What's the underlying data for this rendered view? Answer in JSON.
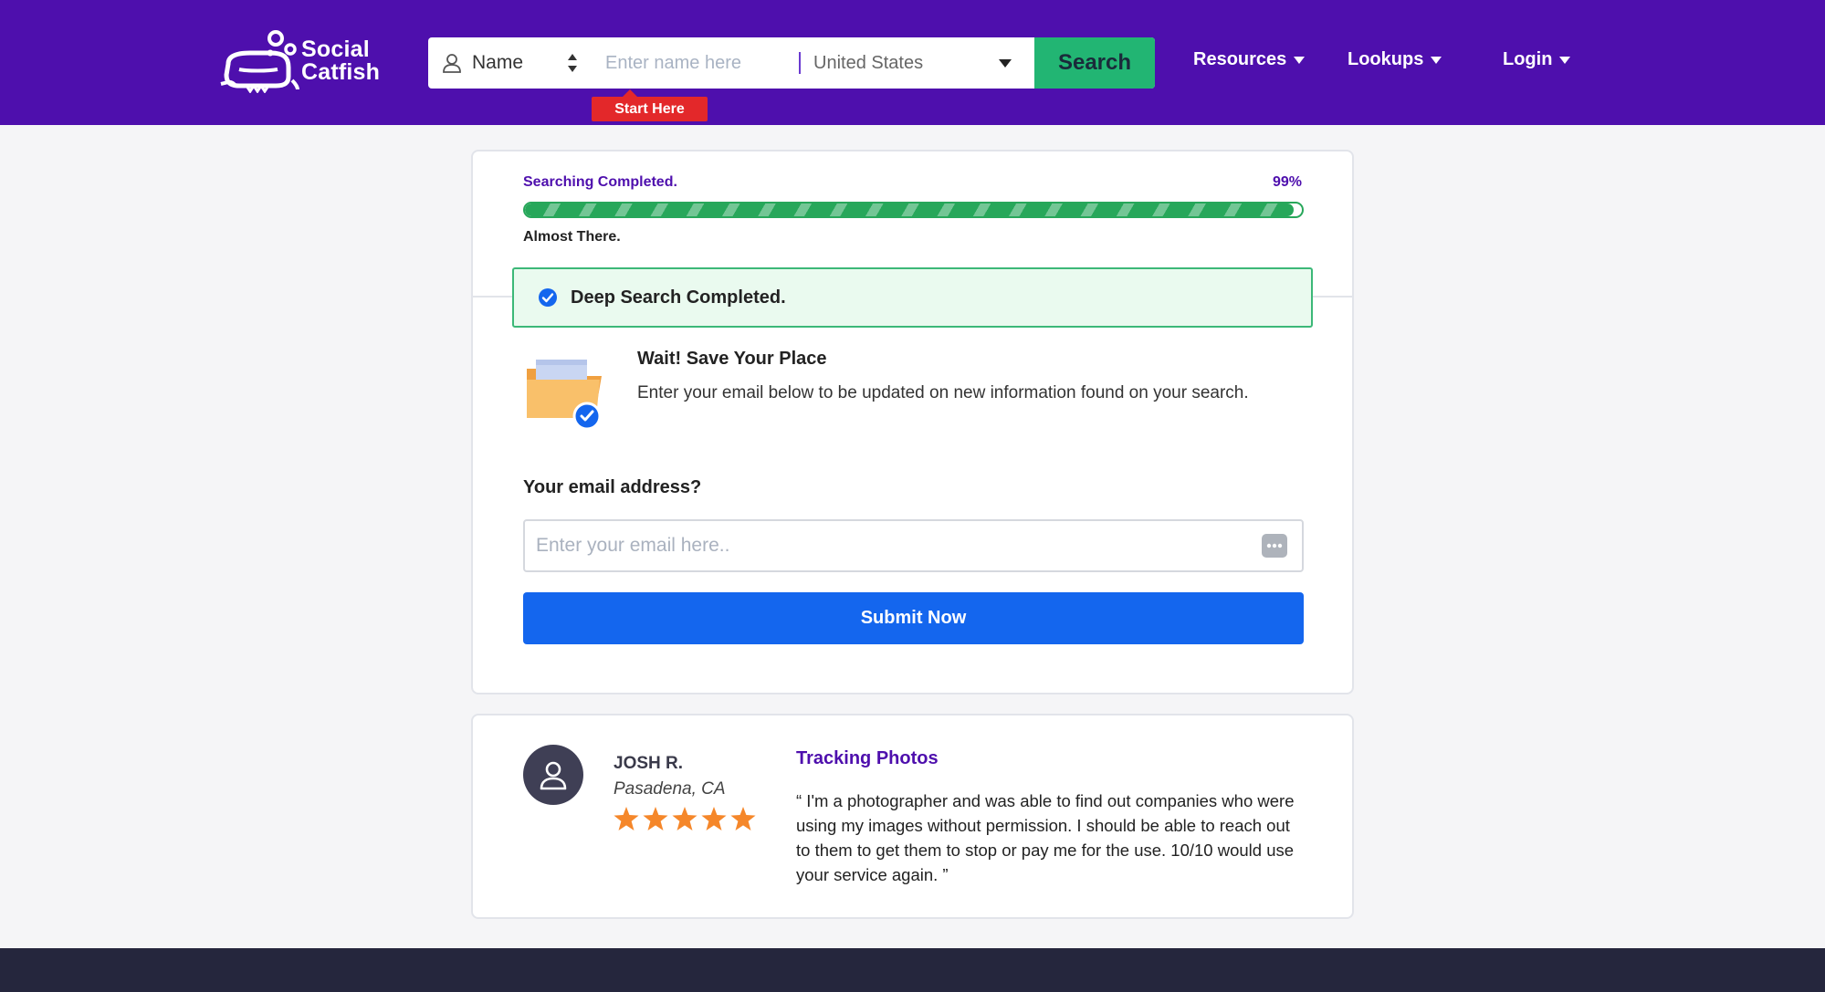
{
  "header": {
    "logo_line1": "Social",
    "logo_line2": "Catfish",
    "search_type": "Name",
    "name_placeholder": "Enter name here",
    "country": "United States",
    "search_button": "Search",
    "start_here": "Start Here",
    "nav": [
      {
        "label": "Resources"
      },
      {
        "label": "Lookups"
      },
      {
        "label": "Login"
      }
    ],
    "colors": {
      "bar": "#4e0fad",
      "search_button": "#22b573",
      "start_here": "#e3282a"
    }
  },
  "progress": {
    "status": "Searching Completed.",
    "percent_label": "99%",
    "percent_value": 0.99,
    "sub_status": "Almost There."
  },
  "success": {
    "icon": "check-circle-icon",
    "text": "Deep Search Completed."
  },
  "save": {
    "icon": "folder-check-icon",
    "title": "Wait! Save Your Place",
    "description": "Enter your email below to be updated on new information found on your search."
  },
  "email": {
    "label": "Your email address?",
    "placeholder": "Enter your email here..",
    "value": "",
    "submit": "Submit Now"
  },
  "review": {
    "name": "JOSH R.",
    "location": "Pasadena, CA",
    "rating": 5,
    "title": "Tracking Photos",
    "body": "“ I'm a photographer and was able to find out companies who were using my images without permission. I should be able to reach out to them to get them to stop or pay me for the use. 10/10 would use your service again. ”"
  }
}
